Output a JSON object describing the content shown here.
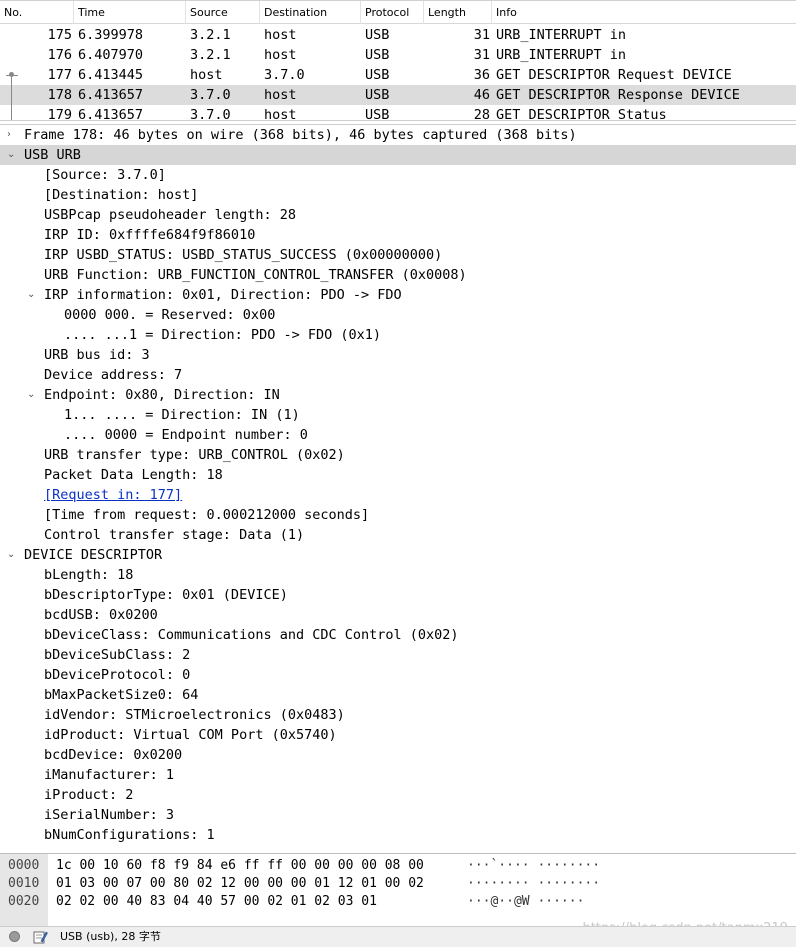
{
  "packet_list": {
    "columns": [
      "No.",
      "Time",
      "Source",
      "Destination",
      "Protocol",
      "Length",
      "Info"
    ],
    "rows": [
      {
        "no": "175",
        "time": "6.399978",
        "src": "3.2.1",
        "dst": "host",
        "proto": "USB",
        "len": "31",
        "info": "URB_INTERRUPT in"
      },
      {
        "no": "176",
        "time": "6.407970",
        "src": "3.2.1",
        "dst": "host",
        "proto": "USB",
        "len": "31",
        "info": "URB_INTERRUPT in"
      },
      {
        "no": "177",
        "time": "6.413445",
        "src": "host",
        "dst": "3.7.0",
        "proto": "USB",
        "len": "36",
        "info": "GET DESCRIPTOR Request DEVICE"
      },
      {
        "no": "178",
        "time": "6.413657",
        "src": "3.7.0",
        "dst": "host",
        "proto": "USB",
        "len": "46",
        "info": "GET DESCRIPTOR Response DEVICE"
      },
      {
        "no": "179",
        "time": "6.413657",
        "src": "3.7.0",
        "dst": "host",
        "proto": "USB",
        "len": "28",
        "info": "GET DESCRIPTOR Status"
      }
    ]
  },
  "details": {
    "lines": [
      {
        "text": "Frame 178: 46 bytes on wire (368 bits), 46 bytes captured (368 bits)"
      },
      {
        "text": "USB URB"
      },
      {
        "text": "[Source: 3.7.0]"
      },
      {
        "text": "[Destination: host]"
      },
      {
        "text": "USBPcap pseudoheader length: 28"
      },
      {
        "text": "IRP ID: 0xffffe684f9f86010"
      },
      {
        "text": "IRP USBD_STATUS: USBD_STATUS_SUCCESS (0x00000000)"
      },
      {
        "text": "URB Function: URB_FUNCTION_CONTROL_TRANSFER (0x0008)"
      },
      {
        "text": "IRP information: 0x01, Direction: PDO -> FDO"
      },
      {
        "text": "0000 000. = Reserved: 0x00"
      },
      {
        "text": ".... ...1 = Direction: PDO -> FDO (0x1)"
      },
      {
        "text": "URB bus id: 3"
      },
      {
        "text": "Device address: 7"
      },
      {
        "text": "Endpoint: 0x80, Direction: IN"
      },
      {
        "text": "1... .... = Direction: IN (1)"
      },
      {
        "text": ".... 0000 = Endpoint number: 0"
      },
      {
        "text": "URB transfer type: URB_CONTROL (0x02)"
      },
      {
        "text": "Packet Data Length: 18"
      },
      {
        "text": "[Request in: 177]"
      },
      {
        "text": "[Time from request: 0.000212000 seconds]"
      },
      {
        "text": "Control transfer stage: Data (1)"
      },
      {
        "text": "DEVICE DESCRIPTOR"
      },
      {
        "text": "bLength: 18"
      },
      {
        "text": "bDescriptorType: 0x01 (DEVICE)"
      },
      {
        "text": "bcdUSB: 0x0200"
      },
      {
        "text": "bDeviceClass: Communications and CDC Control (0x02)"
      },
      {
        "text": "bDeviceSubClass: 2"
      },
      {
        "text": "bDeviceProtocol: 0"
      },
      {
        "text": "bMaxPacketSize0: 64"
      },
      {
        "text": "idVendor: STMicroelectronics (0x0483)"
      },
      {
        "text": "idProduct: Virtual COM Port (0x5740)"
      },
      {
        "text": "bcdDevice: 0x0200"
      },
      {
        "text": "iManufacturer: 1"
      },
      {
        "text": "iProduct: 2"
      },
      {
        "text": "iSerialNumber: 3"
      },
      {
        "text": "bNumConfigurations: 1"
      }
    ]
  },
  "hex": {
    "rows": [
      {
        "offset": "0000",
        "bytes_a": "1c 00 10 60 f8 f9 84 e6",
        "bytes_b": "ff ff 00 00 00 00 08 00",
        "ascii": "···`···· ········"
      },
      {
        "offset": "0010",
        "bytes_a": "01 03 00 07 00 80 02 12",
        "bytes_b": "00 00 00 01 12 01 00 02",
        "ascii": "········ ········"
      },
      {
        "offset": "0020",
        "bytes_a": "02 02 00 40 83 04 40 57",
        "bytes_b": "00 02 01 02 03 01",
        "ascii": "···@··@W ······"
      }
    ],
    "watermark": "https://blog.csdn.net/tanmx219"
  },
  "status_bar": {
    "label": "USB (usb), 28 字节"
  }
}
